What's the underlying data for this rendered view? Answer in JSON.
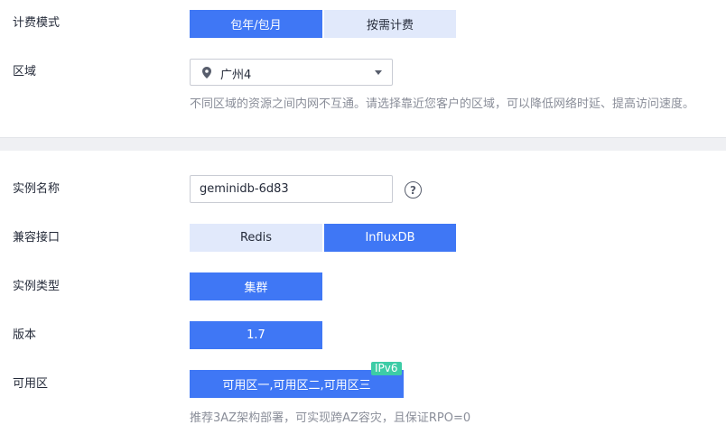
{
  "billing": {
    "label": "计费模式",
    "options": [
      "包年/包月",
      "按需计费"
    ]
  },
  "region": {
    "label": "区域",
    "selected": "广州4",
    "hint": "不同区域的资源之间内网不互通。请选择靠近您客户的区域，可以降低网络时延、提高访问速度。"
  },
  "instance_name": {
    "label": "实例名称",
    "value": "geminidb-6d83",
    "help": "?"
  },
  "compat": {
    "label": "兼容接口",
    "options": [
      "Redis",
      "InfluxDB"
    ]
  },
  "instance_type": {
    "label": "实例类型",
    "value": "集群"
  },
  "version": {
    "label": "版本",
    "value": "1.7"
  },
  "az": {
    "label": "可用区",
    "value": "可用区一,可用区二,可用区三",
    "badge": "IPv6",
    "hint": "推荐3AZ架构部署，可实现跨AZ容灾，且保证RPO=0"
  }
}
